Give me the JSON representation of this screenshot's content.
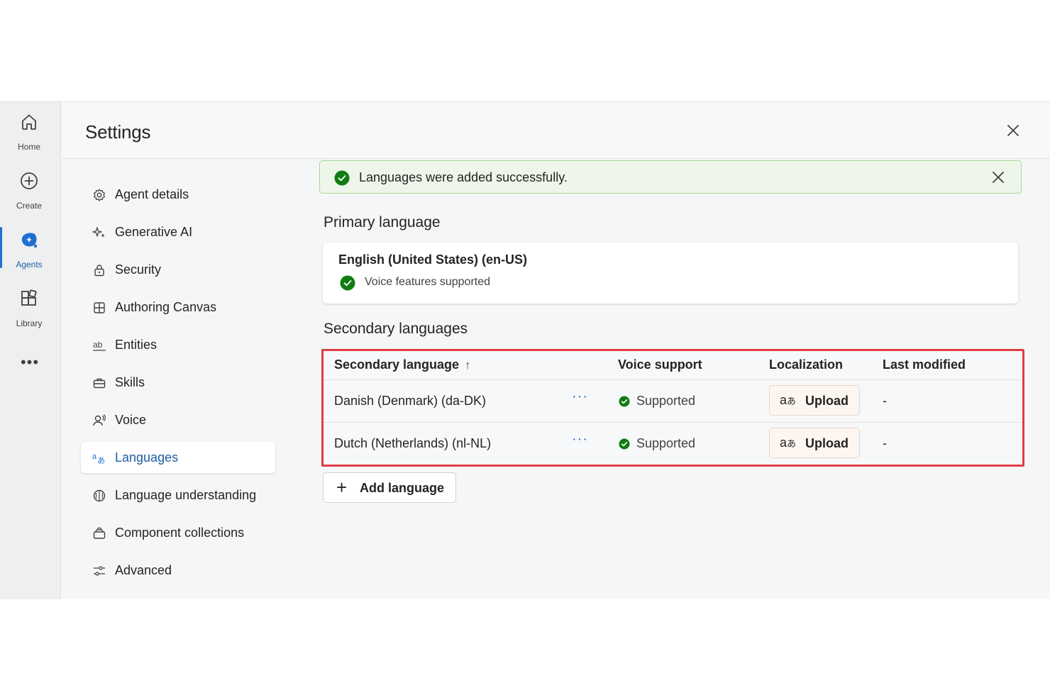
{
  "rail": {
    "items": [
      {
        "label": "Home",
        "icon": "home-icon"
      },
      {
        "label": "Create",
        "icon": "plus-circle-icon"
      },
      {
        "label": "Agents",
        "icon": "agents-icon"
      },
      {
        "label": "Library",
        "icon": "library-icon"
      }
    ],
    "more": "•••",
    "active": "Agents"
  },
  "header": {
    "title": "Settings"
  },
  "nav": {
    "items": [
      {
        "label": "Agent details",
        "icon": "gear-icon"
      },
      {
        "label": "Generative AI",
        "icon": "sparkle-icon"
      },
      {
        "label": "Security",
        "icon": "lock-icon"
      },
      {
        "label": "Authoring Canvas",
        "icon": "grid-icon"
      },
      {
        "label": "Entities",
        "icon": "text-ab-icon"
      },
      {
        "label": "Skills",
        "icon": "toolbox-icon"
      },
      {
        "label": "Voice",
        "icon": "voice-person-icon"
      },
      {
        "label": "Languages",
        "icon": "translate-icon"
      },
      {
        "label": "Language understanding",
        "icon": "brain-icon"
      },
      {
        "label": "Component collections",
        "icon": "collection-icon"
      },
      {
        "label": "Advanced",
        "icon": "sliders-icon"
      }
    ],
    "active": "Languages"
  },
  "toast": {
    "message": "Languages were added successfully."
  },
  "primary": {
    "heading": "Primary language",
    "language": "English (United States) (en-US)",
    "voice_status": "Voice features supported"
  },
  "secondary": {
    "heading": "Secondary languages",
    "columns": {
      "language": "Secondary language",
      "sort_indicator": "↑",
      "voice": "Voice support",
      "localization": "Localization",
      "modified": "Last modified"
    },
    "rows": [
      {
        "language": "Danish (Denmark) (da-DK)",
        "actions": "···",
        "voice": "Supported",
        "localization": "Upload",
        "modified": "-"
      },
      {
        "language": "Dutch (Netherlands) (nl-NL)",
        "actions": "···",
        "voice": "Supported",
        "localization": "Upload",
        "modified": "-"
      }
    ],
    "add_button": "Add language"
  },
  "colors": {
    "accent": "#1e6fd0",
    "success": "#107c10",
    "highlight_border": "#e03d45",
    "toast_bg": "#eef6ea"
  }
}
